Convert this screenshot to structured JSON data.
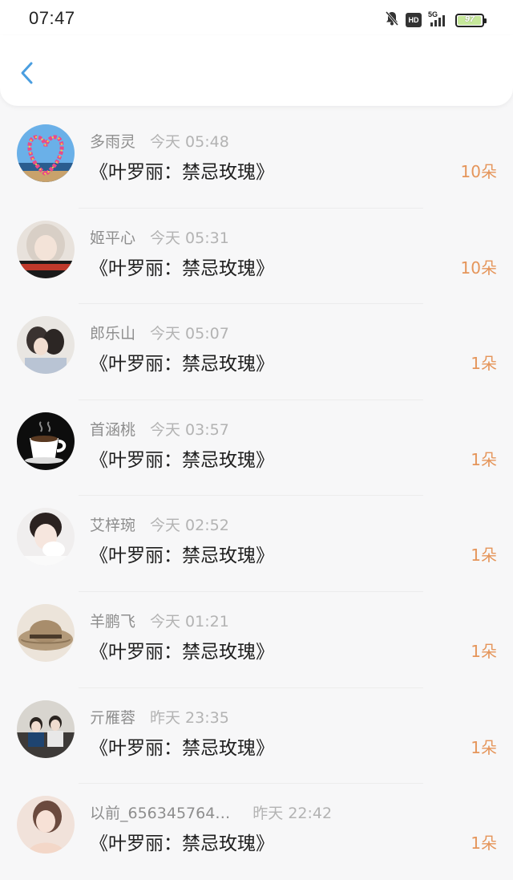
{
  "status_bar": {
    "time": "07:47",
    "network_label": "5G",
    "hd_label": "HD",
    "battery_percent": "97",
    "battery_level": 0.97,
    "icons": [
      "mute-icon",
      "hd-icon",
      "signal-icon",
      "battery-icon"
    ]
  },
  "nav": {
    "back_icon": "chevron-left-icon",
    "accent_color": "#4a9ee0"
  },
  "items": [
    {
      "name": "多雨灵",
      "time": "今天 05:48",
      "title": "《叶罗丽：禁忌玫瑰》",
      "count": "10朵"
    },
    {
      "name": "姬平心",
      "time": "今天 05:31",
      "title": "《叶罗丽：禁忌玫瑰》",
      "count": "10朵"
    },
    {
      "name": "郎乐山",
      "time": "今天 05:07",
      "title": "《叶罗丽：禁忌玫瑰》",
      "count": "1朵"
    },
    {
      "name": "首涵桃",
      "time": "今天 03:57",
      "title": "《叶罗丽：禁忌玫瑰》",
      "count": "1朵"
    },
    {
      "name": "艾梓琬",
      "time": "今天 02:52",
      "title": "《叶罗丽：禁忌玫瑰》",
      "count": "1朵"
    },
    {
      "name": "羊鹏飞",
      "time": "今天 01:21",
      "title": "《叶罗丽：禁忌玫瑰》",
      "count": "1朵"
    },
    {
      "name": "亓雁蓉",
      "time": "昨天 23:35",
      "title": "《叶罗丽：禁忌玫瑰》",
      "count": "1朵"
    },
    {
      "name": "以前_656345764…",
      "time": "昨天 22:42",
      "title": "《叶罗丽：禁忌玫瑰》",
      "count": "1朵"
    }
  ],
  "colors": {
    "count": "#e5955a",
    "name": "#8e8e8e",
    "time": "#b3b3b3",
    "title": "#202020",
    "background": "#f7f7f8"
  }
}
